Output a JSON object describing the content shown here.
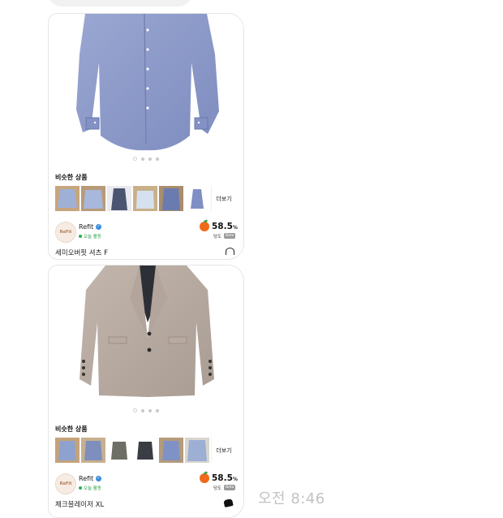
{
  "messages": [
    {
      "similar_title": "비슷한 상품",
      "more_label": "더보기",
      "seller": {
        "name": "Refit",
        "avatar_text": "ReFit",
        "status": "오늘 활동"
      },
      "temperature": {
        "value": "58.5",
        "unit": "%",
        "label": "당도",
        "badge": "Beta"
      },
      "item_title": "세미오버핏 셔츠 F",
      "image_dots": 4
    },
    {
      "similar_title": "비슷한 상품",
      "more_label": "더보기",
      "seller": {
        "name": "Refit",
        "avatar_text": "ReFit",
        "status": "오늘 활동"
      },
      "temperature": {
        "value": "58.5",
        "unit": "%",
        "label": "당도",
        "badge": "Beta"
      },
      "item_title": "체크블레이저 XL",
      "image_dots": 4
    }
  ],
  "timestamp": "오전 8:46",
  "colors": {
    "accent_orange": "#f06a1c",
    "verified_blue": "#3a8dde",
    "active_green": "#27b24a",
    "timestamp_gray": "#c2c2c2"
  },
  "icons": [
    "verified-check-icon",
    "peach-icon",
    "heart-icon",
    "active-status-dot-icon"
  ]
}
